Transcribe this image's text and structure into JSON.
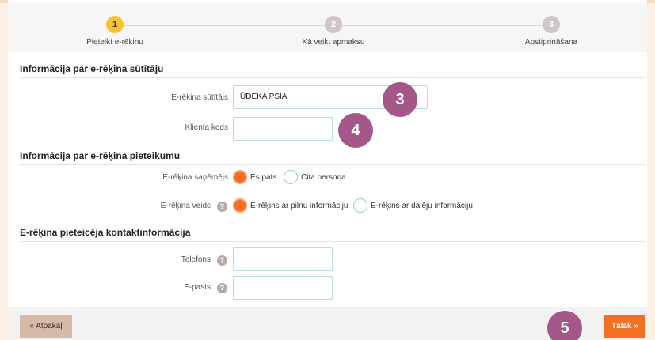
{
  "stepper": {
    "steps": [
      {
        "number": "1",
        "label": "Pieteikt e-rēķinu"
      },
      {
        "number": "2",
        "label": "Kā veikt apmaksu"
      },
      {
        "number": "3",
        "label": "Apstiprināšana"
      }
    ]
  },
  "sender_section": {
    "title": "Informācija par e-rēķina sūtītāju",
    "sender_label": "E-rēķina sūtītājs",
    "sender_value": "ŪDEKA PSIA",
    "client_code_label": "Klienta kods",
    "client_code_value": ""
  },
  "application_section": {
    "title": "Informācija par e-rēķina pieteikumu",
    "receiver_label": "E-rēķina saņēmējs",
    "receiver_options": [
      "Es pats",
      "Cita persona"
    ],
    "receiver_selected": "Es pats",
    "type_label": "E-rēķina veids",
    "type_options": [
      "E-rēķins ar pilnu informāciju",
      "E-rēķins ar daļēju informāciju"
    ],
    "type_selected": "E-rēķins ar pilnu informāciju"
  },
  "contact_section": {
    "title": "E-rēķina pieteicēja kontaktinformācija",
    "phone_label": "Telefons",
    "phone_value": "",
    "email_label": "E-pasts",
    "email_value": ""
  },
  "help_icon_glyph": "?",
  "badges": {
    "b3": "3",
    "b4": "4",
    "b5": "5"
  },
  "footer": {
    "back_label": "« Atpakaļ",
    "next_label": "Tālāk »"
  },
  "colors": {
    "accent": "#f36f21",
    "active_step": "#f6c52e",
    "badge": "#a5578a",
    "input_border": "#b7dcd9"
  }
}
